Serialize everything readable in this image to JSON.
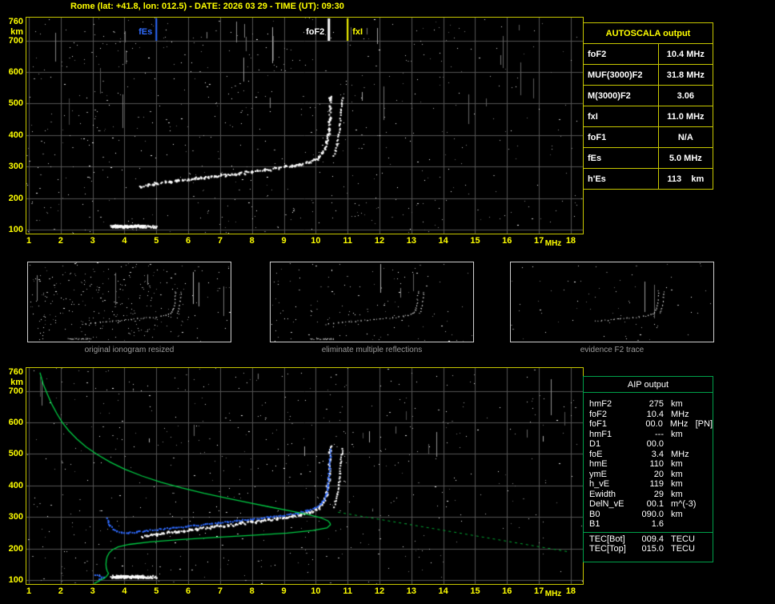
{
  "header": {
    "title": "Rome (lat: +41.8, lon: 012.5) - DATE: 2026 03 29 - TIME (UT): 09:30"
  },
  "colors": {
    "axis_yellow": "#ffff00",
    "border_yellow": "#c8c800",
    "grid_gray": "#545454",
    "trace_white": "#ffffff",
    "profile_green": "#00cc44",
    "restored_blue": "#2f6bff",
    "alert_red": "#ff0000",
    "aip_green": "#00a04a",
    "caption_gray": "#9a9a9a"
  },
  "autoscala": {
    "title": "AUTOSCALA output",
    "rows": [
      {
        "label": "foF2",
        "value": "10.4 MHz",
        "color": "#ffffff"
      },
      {
        "label": "MUF(3000)F2",
        "value": "31.8 MHz",
        "color": "#ffffff"
      },
      {
        "label": "M(3000)F2",
        "value": "3.06",
        "color": "#ffffff"
      },
      {
        "label": "fxI",
        "value": "11.0 MHz",
        "color": "#ffff00"
      },
      {
        "label": "foF1",
        "value": "N/A",
        "color": "#ff0000"
      },
      {
        "label": "fEs",
        "value": "5.0 MHz",
        "color": "#2f6bff"
      },
      {
        "label": "h'Es",
        "value": "113    km",
        "color": "#ffffff"
      }
    ]
  },
  "panels": [
    {
      "caption": "original ionogram resized"
    },
    {
      "caption": "eliminate multiple reflections"
    },
    {
      "caption": "evidence F2 trace"
    }
  ],
  "aip": {
    "title": "AIP output",
    "rows": [
      {
        "label": "hmF2",
        "value": "275",
        "unit": "km"
      },
      {
        "label": "foF2",
        "value": "10.4",
        "unit": "MHz"
      },
      {
        "label": "foF1",
        "value": "00.0",
        "unit": "MHz   [PN]"
      },
      {
        "label": "hmF1",
        "value": "---",
        "unit": "km"
      },
      {
        "label": "D1",
        "value": "00.0",
        "unit": ""
      },
      {
        "label": "foE",
        "value": "3.4",
        "unit": "MHz"
      },
      {
        "label": "hmE",
        "value": "110",
        "unit": "km"
      },
      {
        "label": "ymE",
        "value": "20",
        "unit": "km"
      },
      {
        "label": "h_vE",
        "value": "119",
        "unit": "km"
      },
      {
        "label": "Ewidth",
        "value": "29",
        "unit": "km"
      },
      {
        "label": "DelN_vE",
        "value": "00.1",
        "unit": "m^(-3)"
      },
      {
        "label": "B0",
        "value": "090.0",
        "unit": "km"
      },
      {
        "label": "B1",
        "value": "1.6",
        "unit": ""
      }
    ],
    "tec_rows": [
      {
        "label": "TEC[Bot]",
        "value": "009.4",
        "unit": "TECU"
      },
      {
        "label": "TEC[Top]",
        "value": "015.0",
        "unit": "TECU"
      }
    ]
  },
  "chart_data": {
    "type": "scatter",
    "title": "Rome ionogram 2026 03 29 09:30 UT with AUTOSCALA scaling and AIP electron density profile",
    "x_axis": {
      "label": "MHz",
      "min": 1,
      "max": 18.4,
      "ticks": [
        1,
        2,
        3,
        4,
        5,
        6,
        7,
        8,
        9,
        10,
        11,
        12,
        13,
        14,
        15,
        16,
        17,
        18
      ]
    },
    "y_axis": {
      "label": "km",
      "min": 84,
      "max": 760,
      "ticks": [
        760,
        700,
        600,
        500,
        400,
        300,
        200,
        100
      ]
    },
    "markers": [
      {
        "label": "fEs",
        "freq": 5.0,
        "color": "#2f6bff",
        "side": "left"
      },
      {
        "label": "foF2",
        "freq": 10.4,
        "color": "#ffffff",
        "side": "left"
      },
      {
        "label": "fxI",
        "freq": 11.0,
        "color": "#ffff00",
        "side": "right"
      }
    ],
    "series": {
      "f2_trace": {
        "style": "dots",
        "color": "#ffffff",
        "size": 2,
        "step": 2.2,
        "jitter": 1.2,
        "thick": true,
        "points": [
          [
            4.5,
            238
          ],
          [
            4.7,
            243
          ],
          [
            5.0,
            248
          ],
          [
            5.3,
            252
          ],
          [
            5.6,
            256
          ],
          [
            6.0,
            261
          ],
          [
            6.4,
            266
          ],
          [
            6.8,
            271
          ],
          [
            7.2,
            276
          ],
          [
            7.6,
            281
          ],
          [
            8.0,
            287
          ],
          [
            8.4,
            292
          ],
          [
            8.8,
            297
          ],
          [
            9.2,
            303
          ],
          [
            9.5,
            309
          ],
          [
            9.8,
            317
          ],
          [
            10.0,
            326
          ],
          [
            10.1,
            334
          ],
          [
            10.2,
            345
          ],
          [
            10.27,
            360
          ],
          [
            10.32,
            378
          ],
          [
            10.36,
            400
          ],
          [
            10.39,
            425
          ],
          [
            10.41,
            455
          ],
          [
            10.43,
            485
          ],
          [
            10.44,
            510
          ],
          [
            10.45,
            525
          ]
        ]
      },
      "f2_xmode": {
        "style": "dots",
        "color": "#ffffff",
        "size": 2,
        "step": 3,
        "jitter": 0.9,
        "points": [
          [
            10.55,
            335
          ],
          [
            10.6,
            352
          ],
          [
            10.65,
            375
          ],
          [
            10.7,
            403
          ],
          [
            10.74,
            438
          ],
          [
            10.77,
            472
          ],
          [
            10.79,
            500
          ],
          [
            10.81,
            520
          ]
        ]
      },
      "es_band": {
        "style": "band",
        "color": "#ffffff",
        "f_start": 3.55,
        "f_end": 5.0,
        "km": 112,
        "spread": 5
      },
      "blue_trace": {
        "style": "dots",
        "color": "#2f6bff",
        "size": 2,
        "step": 2.6,
        "jitter": 0.9,
        "points": [
          [
            3.42,
            298
          ],
          [
            3.47,
            286
          ],
          [
            3.53,
            274
          ],
          [
            3.62,
            264
          ],
          [
            3.75,
            257
          ],
          [
            3.9,
            253
          ],
          [
            4.1,
            252
          ],
          [
            4.35,
            254
          ],
          [
            4.6,
            258
          ],
          [
            5.0,
            262
          ],
          [
            5.5,
            268
          ],
          [
            6.0,
            273
          ],
          [
            6.5,
            279
          ],
          [
            7.0,
            284
          ],
          [
            7.5,
            290
          ],
          [
            8.0,
            295
          ],
          [
            8.5,
            301
          ],
          [
            9.0,
            307
          ],
          [
            9.4,
            314
          ],
          [
            9.7,
            322
          ],
          [
            9.95,
            331
          ],
          [
            10.12,
            342
          ],
          [
            10.24,
            356
          ],
          [
            10.31,
            374
          ],
          [
            10.36,
            398
          ],
          [
            10.39,
            428
          ],
          [
            10.41,
            460
          ],
          [
            10.43,
            492
          ],
          [
            10.44,
            515
          ]
        ]
      },
      "blue_es": {
        "style": "dots",
        "color": "#2f6bff",
        "size": 2,
        "step": 3,
        "jitter": 1,
        "points": [
          [
            3.08,
            120
          ],
          [
            3.2,
            114
          ],
          [
            3.32,
            109
          ],
          [
            3.2,
            106
          ]
        ]
      },
      "green_profile": {
        "style": "line",
        "color": "#00cc44",
        "width": 1.3,
        "points": [
          [
            1.35,
            758
          ],
          [
            1.45,
            722
          ],
          [
            1.58,
            690
          ],
          [
            1.72,
            658
          ],
          [
            1.88,
            628
          ],
          [
            2.05,
            600
          ],
          [
            2.25,
            574
          ],
          [
            2.5,
            548
          ],
          [
            2.8,
            522
          ],
          [
            3.15,
            498
          ],
          [
            3.55,
            474
          ],
          [
            4.0,
            452
          ],
          [
            4.55,
            430
          ],
          [
            5.15,
            410
          ],
          [
            5.8,
            392
          ],
          [
            6.5,
            375
          ],
          [
            7.2,
            360
          ],
          [
            7.9,
            345
          ],
          [
            8.6,
            331
          ],
          [
            9.2,
            319
          ],
          [
            9.75,
            308
          ],
          [
            10.15,
            298
          ],
          [
            10.38,
            288
          ],
          [
            10.45,
            280
          ],
          [
            10.46,
            275
          ],
          [
            10.35,
            265
          ],
          [
            9.9,
            257
          ],
          [
            9.1,
            249
          ],
          [
            8.0,
            242
          ],
          [
            6.8,
            235
          ],
          [
            5.7,
            228
          ],
          [
            4.8,
            221
          ],
          [
            4.15,
            213
          ],
          [
            3.8,
            205
          ],
          [
            3.62,
            196
          ],
          [
            3.52,
            186
          ],
          [
            3.46,
            175
          ],
          [
            3.43,
            163
          ],
          [
            3.42,
            150
          ],
          [
            3.43,
            138
          ],
          [
            3.46,
            128
          ],
          [
            3.5,
            121
          ],
          [
            3.46,
            115
          ],
          [
            3.42,
            110
          ],
          [
            3.36,
            105
          ],
          [
            3.26,
            100
          ],
          [
            3.15,
            94
          ],
          [
            3.05,
            89
          ]
        ]
      },
      "green_dotted": {
        "style": "dashline",
        "color": "#00aa33",
        "width": 1,
        "dash": [
          3,
          4
        ],
        "points": [
          [
            10.7,
            315
          ],
          [
            17.9,
            190
          ]
        ]
      }
    },
    "plots": {
      "main": {
        "canvas": "cv-main",
        "series": [
          "es_band",
          "f2_trace",
          "f2_xmode"
        ],
        "noise": {
          "seed": 11,
          "dots": 620,
          "streaks": 26
        },
        "markers": true
      },
      "profile": {
        "canvas": "cv-bottom",
        "series": [
          "es_band",
          "f2_trace",
          "f2_xmode",
          "blue_es",
          "blue_trace",
          "green_profile",
          "green_dotted"
        ],
        "noise": {
          "seed": 29,
          "dots": 520,
          "streaks": 16
        }
      },
      "mini_original": {
        "canvas": "cv-p1",
        "mini": true,
        "series": [
          "es_band",
          "f2_trace",
          "f2_xmode"
        ],
        "noise": {
          "seed": 101,
          "dots": 300,
          "streaks": 6
        }
      },
      "mini_cleaned": {
        "canvas": "cv-p2",
        "mini": true,
        "series": [
          "es_band",
          "f2_trace",
          "f2_xmode"
        ],
        "noise": {
          "seed": 202,
          "dots": 130,
          "streaks": 3
        }
      },
      "mini_f2": {
        "canvas": "cv-p3",
        "mini": true,
        "series": [
          "f2_trace",
          "f2_xmode"
        ],
        "fclip": 6.2,
        "noise": {
          "seed": 303,
          "dots": 70,
          "streaks": 2
        }
      }
    }
  }
}
